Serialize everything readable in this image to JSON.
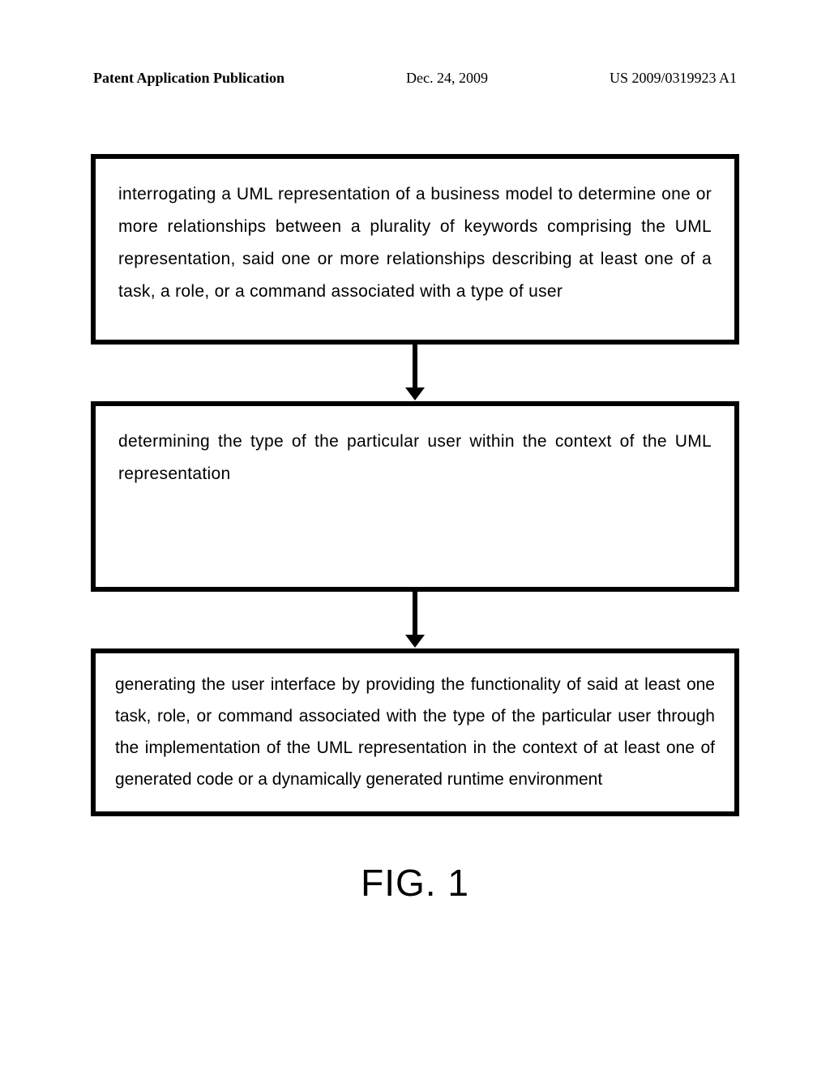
{
  "header": {
    "left": "Patent Application Publication",
    "center": "Dec. 24, 2009",
    "right": "US 2009/0319923 A1"
  },
  "diagram": {
    "box1": "interrogating a UML representation of a business model to determine one or more relationships between a plurality of keywords comprising the UML representation, said one or more relationships describing at least one of a task, a role, or a command associated with a type of user",
    "box2": "determining the type of the particular user within the context of the UML representation",
    "box3": "generating the user interface by providing the functionality of said at least one task, role, or command associated with the type of the particular user through the implementation of the UML representation in the context of at least one of generated code or a dynamically generated runtime environment",
    "figure_label": "FIG. 1"
  }
}
